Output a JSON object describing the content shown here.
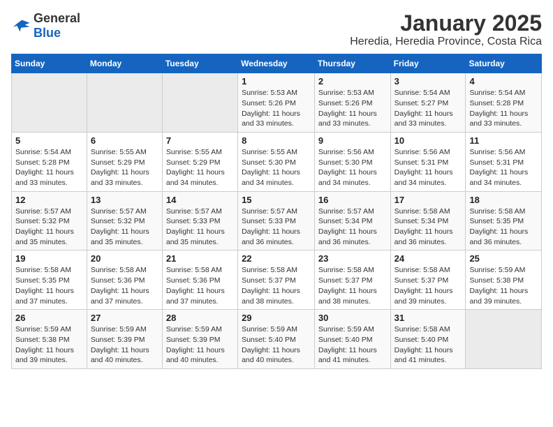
{
  "logo": {
    "general": "General",
    "blue": "Blue"
  },
  "title": "January 2025",
  "subtitle": "Heredia, Heredia Province, Costa Rica",
  "weekdays": [
    "Sunday",
    "Monday",
    "Tuesday",
    "Wednesday",
    "Thursday",
    "Friday",
    "Saturday"
  ],
  "weeks": [
    [
      {
        "day": "",
        "info": ""
      },
      {
        "day": "",
        "info": ""
      },
      {
        "day": "",
        "info": ""
      },
      {
        "day": "1",
        "info": "Sunrise: 5:53 AM\nSunset: 5:26 PM\nDaylight: 11 hours and 33 minutes."
      },
      {
        "day": "2",
        "info": "Sunrise: 5:53 AM\nSunset: 5:26 PM\nDaylight: 11 hours and 33 minutes."
      },
      {
        "day": "3",
        "info": "Sunrise: 5:54 AM\nSunset: 5:27 PM\nDaylight: 11 hours and 33 minutes."
      },
      {
        "day": "4",
        "info": "Sunrise: 5:54 AM\nSunset: 5:28 PM\nDaylight: 11 hours and 33 minutes."
      }
    ],
    [
      {
        "day": "5",
        "info": "Sunrise: 5:54 AM\nSunset: 5:28 PM\nDaylight: 11 hours and 33 minutes."
      },
      {
        "day": "6",
        "info": "Sunrise: 5:55 AM\nSunset: 5:29 PM\nDaylight: 11 hours and 33 minutes."
      },
      {
        "day": "7",
        "info": "Sunrise: 5:55 AM\nSunset: 5:29 PM\nDaylight: 11 hours and 34 minutes."
      },
      {
        "day": "8",
        "info": "Sunrise: 5:55 AM\nSunset: 5:30 PM\nDaylight: 11 hours and 34 minutes."
      },
      {
        "day": "9",
        "info": "Sunrise: 5:56 AM\nSunset: 5:30 PM\nDaylight: 11 hours and 34 minutes."
      },
      {
        "day": "10",
        "info": "Sunrise: 5:56 AM\nSunset: 5:31 PM\nDaylight: 11 hours and 34 minutes."
      },
      {
        "day": "11",
        "info": "Sunrise: 5:56 AM\nSunset: 5:31 PM\nDaylight: 11 hours and 34 minutes."
      }
    ],
    [
      {
        "day": "12",
        "info": "Sunrise: 5:57 AM\nSunset: 5:32 PM\nDaylight: 11 hours and 35 minutes."
      },
      {
        "day": "13",
        "info": "Sunrise: 5:57 AM\nSunset: 5:32 PM\nDaylight: 11 hours and 35 minutes."
      },
      {
        "day": "14",
        "info": "Sunrise: 5:57 AM\nSunset: 5:33 PM\nDaylight: 11 hours and 35 minutes."
      },
      {
        "day": "15",
        "info": "Sunrise: 5:57 AM\nSunset: 5:33 PM\nDaylight: 11 hours and 36 minutes."
      },
      {
        "day": "16",
        "info": "Sunrise: 5:57 AM\nSunset: 5:34 PM\nDaylight: 11 hours and 36 minutes."
      },
      {
        "day": "17",
        "info": "Sunrise: 5:58 AM\nSunset: 5:34 PM\nDaylight: 11 hours and 36 minutes."
      },
      {
        "day": "18",
        "info": "Sunrise: 5:58 AM\nSunset: 5:35 PM\nDaylight: 11 hours and 36 minutes."
      }
    ],
    [
      {
        "day": "19",
        "info": "Sunrise: 5:58 AM\nSunset: 5:35 PM\nDaylight: 11 hours and 37 minutes."
      },
      {
        "day": "20",
        "info": "Sunrise: 5:58 AM\nSunset: 5:36 PM\nDaylight: 11 hours and 37 minutes."
      },
      {
        "day": "21",
        "info": "Sunrise: 5:58 AM\nSunset: 5:36 PM\nDaylight: 11 hours and 37 minutes."
      },
      {
        "day": "22",
        "info": "Sunrise: 5:58 AM\nSunset: 5:37 PM\nDaylight: 11 hours and 38 minutes."
      },
      {
        "day": "23",
        "info": "Sunrise: 5:58 AM\nSunset: 5:37 PM\nDaylight: 11 hours and 38 minutes."
      },
      {
        "day": "24",
        "info": "Sunrise: 5:58 AM\nSunset: 5:37 PM\nDaylight: 11 hours and 39 minutes."
      },
      {
        "day": "25",
        "info": "Sunrise: 5:59 AM\nSunset: 5:38 PM\nDaylight: 11 hours and 39 minutes."
      }
    ],
    [
      {
        "day": "26",
        "info": "Sunrise: 5:59 AM\nSunset: 5:38 PM\nDaylight: 11 hours and 39 minutes."
      },
      {
        "day": "27",
        "info": "Sunrise: 5:59 AM\nSunset: 5:39 PM\nDaylight: 11 hours and 40 minutes."
      },
      {
        "day": "28",
        "info": "Sunrise: 5:59 AM\nSunset: 5:39 PM\nDaylight: 11 hours and 40 minutes."
      },
      {
        "day": "29",
        "info": "Sunrise: 5:59 AM\nSunset: 5:40 PM\nDaylight: 11 hours and 40 minutes."
      },
      {
        "day": "30",
        "info": "Sunrise: 5:59 AM\nSunset: 5:40 PM\nDaylight: 11 hours and 41 minutes."
      },
      {
        "day": "31",
        "info": "Sunrise: 5:58 AM\nSunset: 5:40 PM\nDaylight: 11 hours and 41 minutes."
      },
      {
        "day": "",
        "info": ""
      }
    ]
  ]
}
